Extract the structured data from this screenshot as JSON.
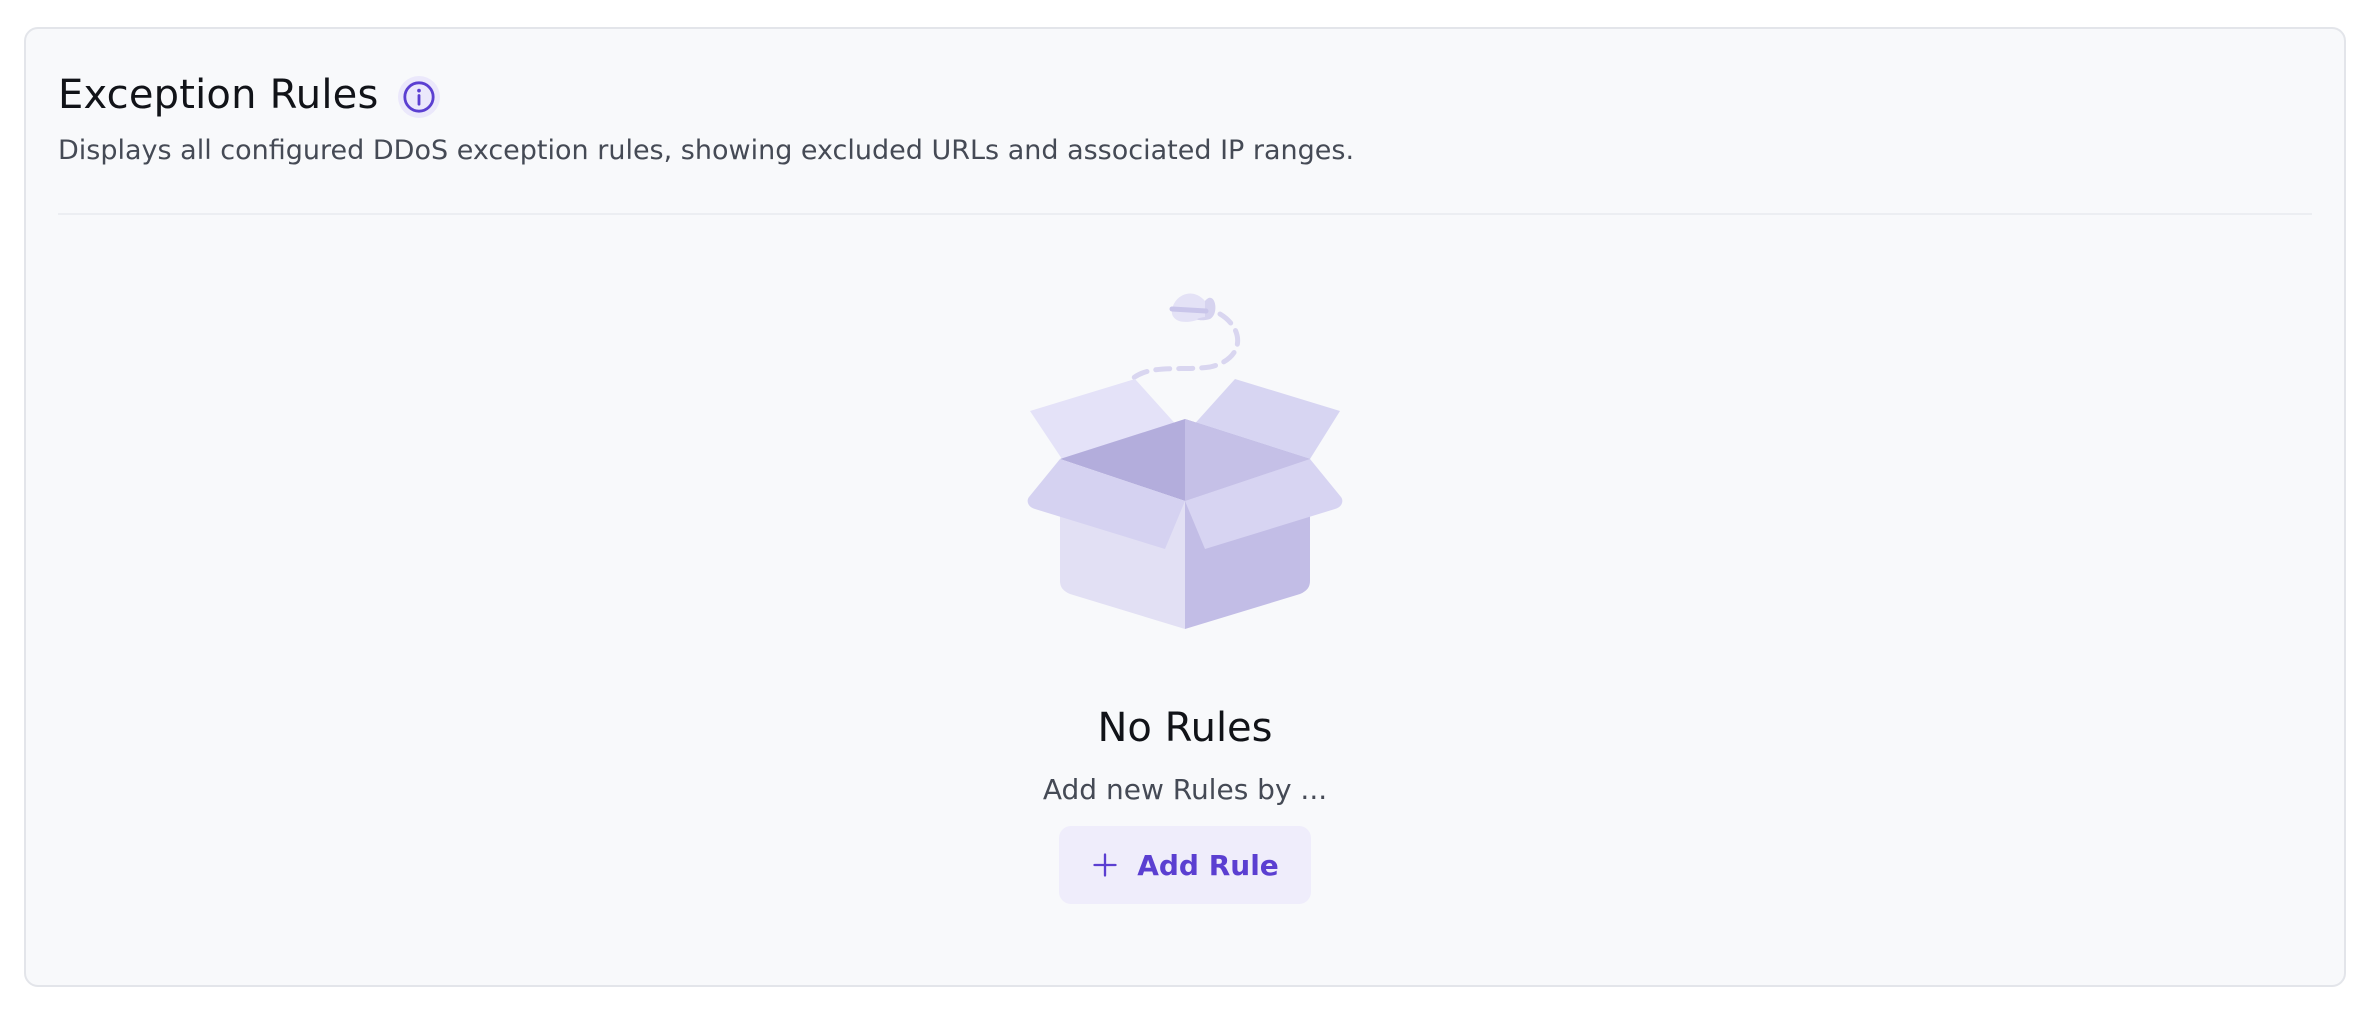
{
  "panel": {
    "title": "Exception Rules",
    "subtitle": "Displays all configured DDoS exception rules, showing excluded URLs and associated IP ranges.",
    "info_icon": "info-circle-icon"
  },
  "empty_state": {
    "illustration": "open-box-with-butterfly",
    "title": "No Rules",
    "description": "Add new Rules by ...",
    "button_label": "Add Rule",
    "button_icon": "plus-icon"
  },
  "colors": {
    "accent": "#5b3fd1",
    "card_background": "#f8f9fb",
    "button_background": "#efedfb"
  }
}
